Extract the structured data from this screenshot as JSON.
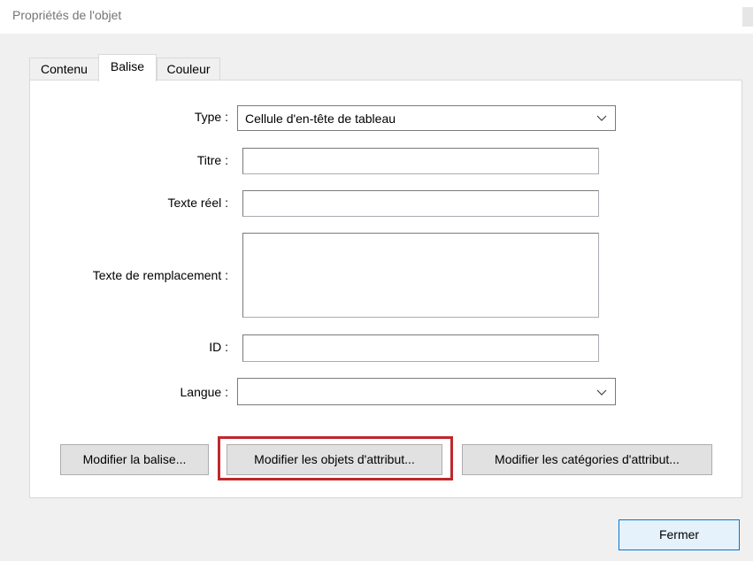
{
  "window": {
    "title": "Propriétés de l'objet"
  },
  "tabs": [
    {
      "label": "Contenu",
      "active": false
    },
    {
      "label": "Balise",
      "active": true
    },
    {
      "label": "Couleur",
      "active": false
    }
  ],
  "form": {
    "type_label": "Type :",
    "type_value": "Cellule d'en-tête de tableau",
    "titre_label": "Titre :",
    "titre_value": "",
    "texte_reel_label": "Texte réel :",
    "texte_reel_value": "",
    "texte_remplacement_label": "Texte de remplacement :",
    "texte_remplacement_value": "",
    "id_label": "ID :",
    "id_value": "",
    "langue_label": "Langue :",
    "langue_value": ""
  },
  "buttons": {
    "modifier_balise": "Modifier la balise...",
    "modifier_objets_attribut": "Modifier les objets d'attribut...",
    "modifier_categories_attribut": "Modifier les catégories d'attribut...",
    "fermer": "Fermer"
  },
  "colors": {
    "highlight": "#c0272d",
    "primary_button_border": "#0078d7"
  },
  "icons": {
    "dropdown": "chevron-down-icon"
  }
}
